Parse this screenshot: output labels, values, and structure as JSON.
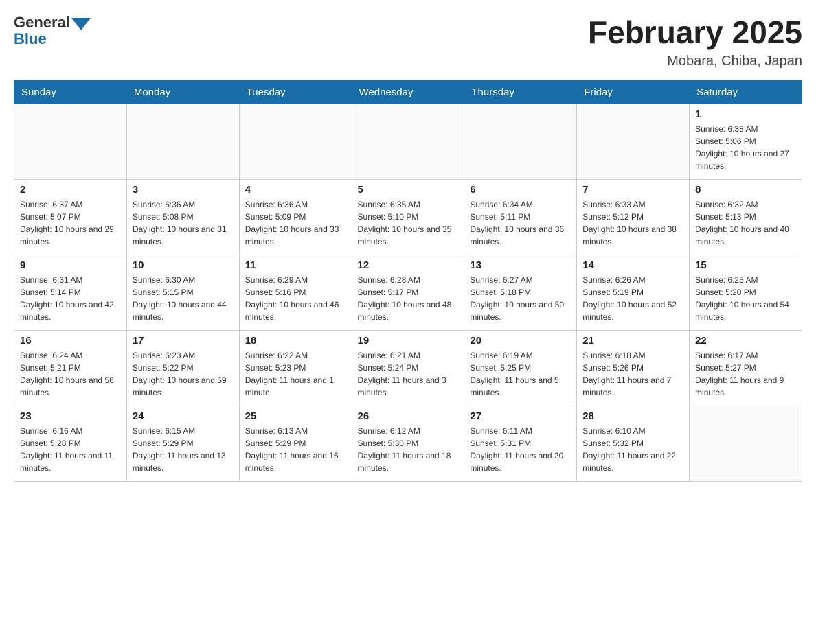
{
  "header": {
    "logo_general": "General",
    "logo_blue": "Blue",
    "month_title": "February 2025",
    "location": "Mobara, Chiba, Japan"
  },
  "weekdays": [
    "Sunday",
    "Monday",
    "Tuesday",
    "Wednesday",
    "Thursday",
    "Friday",
    "Saturday"
  ],
  "weeks": [
    [
      {
        "day": "",
        "info": ""
      },
      {
        "day": "",
        "info": ""
      },
      {
        "day": "",
        "info": ""
      },
      {
        "day": "",
        "info": ""
      },
      {
        "day": "",
        "info": ""
      },
      {
        "day": "",
        "info": ""
      },
      {
        "day": "1",
        "info": "Sunrise: 6:38 AM\nSunset: 5:06 PM\nDaylight: 10 hours and 27 minutes."
      }
    ],
    [
      {
        "day": "2",
        "info": "Sunrise: 6:37 AM\nSunset: 5:07 PM\nDaylight: 10 hours and 29 minutes."
      },
      {
        "day": "3",
        "info": "Sunrise: 6:36 AM\nSunset: 5:08 PM\nDaylight: 10 hours and 31 minutes."
      },
      {
        "day": "4",
        "info": "Sunrise: 6:36 AM\nSunset: 5:09 PM\nDaylight: 10 hours and 33 minutes."
      },
      {
        "day": "5",
        "info": "Sunrise: 6:35 AM\nSunset: 5:10 PM\nDaylight: 10 hours and 35 minutes."
      },
      {
        "day": "6",
        "info": "Sunrise: 6:34 AM\nSunset: 5:11 PM\nDaylight: 10 hours and 36 minutes."
      },
      {
        "day": "7",
        "info": "Sunrise: 6:33 AM\nSunset: 5:12 PM\nDaylight: 10 hours and 38 minutes."
      },
      {
        "day": "8",
        "info": "Sunrise: 6:32 AM\nSunset: 5:13 PM\nDaylight: 10 hours and 40 minutes."
      }
    ],
    [
      {
        "day": "9",
        "info": "Sunrise: 6:31 AM\nSunset: 5:14 PM\nDaylight: 10 hours and 42 minutes."
      },
      {
        "day": "10",
        "info": "Sunrise: 6:30 AM\nSunset: 5:15 PM\nDaylight: 10 hours and 44 minutes."
      },
      {
        "day": "11",
        "info": "Sunrise: 6:29 AM\nSunset: 5:16 PM\nDaylight: 10 hours and 46 minutes."
      },
      {
        "day": "12",
        "info": "Sunrise: 6:28 AM\nSunset: 5:17 PM\nDaylight: 10 hours and 48 minutes."
      },
      {
        "day": "13",
        "info": "Sunrise: 6:27 AM\nSunset: 5:18 PM\nDaylight: 10 hours and 50 minutes."
      },
      {
        "day": "14",
        "info": "Sunrise: 6:26 AM\nSunset: 5:19 PM\nDaylight: 10 hours and 52 minutes."
      },
      {
        "day": "15",
        "info": "Sunrise: 6:25 AM\nSunset: 5:20 PM\nDaylight: 10 hours and 54 minutes."
      }
    ],
    [
      {
        "day": "16",
        "info": "Sunrise: 6:24 AM\nSunset: 5:21 PM\nDaylight: 10 hours and 56 minutes."
      },
      {
        "day": "17",
        "info": "Sunrise: 6:23 AM\nSunset: 5:22 PM\nDaylight: 10 hours and 59 minutes."
      },
      {
        "day": "18",
        "info": "Sunrise: 6:22 AM\nSunset: 5:23 PM\nDaylight: 11 hours and 1 minute."
      },
      {
        "day": "19",
        "info": "Sunrise: 6:21 AM\nSunset: 5:24 PM\nDaylight: 11 hours and 3 minutes."
      },
      {
        "day": "20",
        "info": "Sunrise: 6:19 AM\nSunset: 5:25 PM\nDaylight: 11 hours and 5 minutes."
      },
      {
        "day": "21",
        "info": "Sunrise: 6:18 AM\nSunset: 5:26 PM\nDaylight: 11 hours and 7 minutes."
      },
      {
        "day": "22",
        "info": "Sunrise: 6:17 AM\nSunset: 5:27 PM\nDaylight: 11 hours and 9 minutes."
      }
    ],
    [
      {
        "day": "23",
        "info": "Sunrise: 6:16 AM\nSunset: 5:28 PM\nDaylight: 11 hours and 11 minutes."
      },
      {
        "day": "24",
        "info": "Sunrise: 6:15 AM\nSunset: 5:29 PM\nDaylight: 11 hours and 13 minutes."
      },
      {
        "day": "25",
        "info": "Sunrise: 6:13 AM\nSunset: 5:29 PM\nDaylight: 11 hours and 16 minutes."
      },
      {
        "day": "26",
        "info": "Sunrise: 6:12 AM\nSunset: 5:30 PM\nDaylight: 11 hours and 18 minutes."
      },
      {
        "day": "27",
        "info": "Sunrise: 6:11 AM\nSunset: 5:31 PM\nDaylight: 11 hours and 20 minutes."
      },
      {
        "day": "28",
        "info": "Sunrise: 6:10 AM\nSunset: 5:32 PM\nDaylight: 11 hours and 22 minutes."
      },
      {
        "day": "",
        "info": ""
      }
    ]
  ]
}
